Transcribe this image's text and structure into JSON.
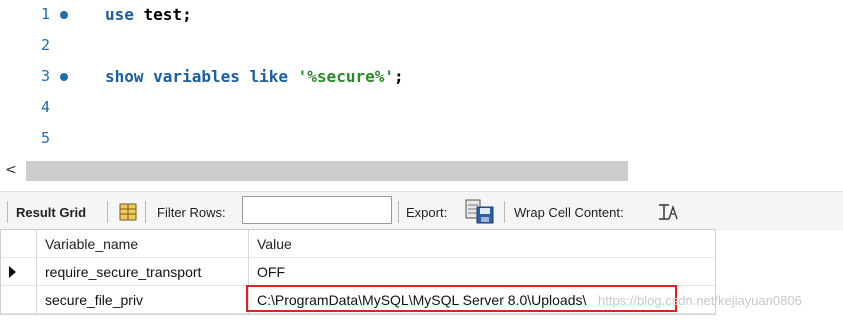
{
  "editor": {
    "lines": [
      {
        "number": "1",
        "has_marker": true,
        "tokens": [
          {
            "text": "use ",
            "class": "kw"
          },
          {
            "text": "test",
            "class": "id"
          },
          {
            "text": ";",
            "class": "punct"
          }
        ]
      },
      {
        "number": "2",
        "has_marker": false,
        "tokens": []
      },
      {
        "number": "3",
        "has_marker": true,
        "tokens": [
          {
            "text": "show variables like ",
            "class": "kw"
          },
          {
            "text": "'%secure%'",
            "class": "str"
          },
          {
            "text": ";",
            "class": "punct"
          }
        ]
      },
      {
        "number": "4",
        "has_marker": false,
        "tokens": []
      },
      {
        "number": "5",
        "has_marker": false,
        "tokens": []
      }
    ]
  },
  "scrollbar": {
    "left_arrow": "<"
  },
  "toolbar": {
    "result_grid_label": "Result Grid",
    "filter_rows_label": "Filter Rows:",
    "filter_rows_value": "",
    "export_label": "Export:",
    "wrap_cell_label": "Wrap Cell Content:",
    "icons": [
      "grid-layout-icon",
      "export-save-icon",
      "wrap-text-icon"
    ]
  },
  "grid": {
    "columns": [
      "Variable_name",
      "Value"
    ],
    "rows": [
      {
        "variable_name": "require_secure_transport",
        "value": "OFF",
        "current": true
      },
      {
        "variable_name": "secure_file_priv",
        "value": "C:\\ProgramData\\MySQL\\MySQL Server 8.0\\Uploads\\",
        "current": false
      }
    ]
  },
  "watermark": "https://blog.csdn.net/kejiayuan0806",
  "colors": {
    "keyword": "#1a5fa0",
    "string": "#2a8a2a",
    "line_number": "#1f6ea8",
    "highlight_border": "#e02020"
  }
}
